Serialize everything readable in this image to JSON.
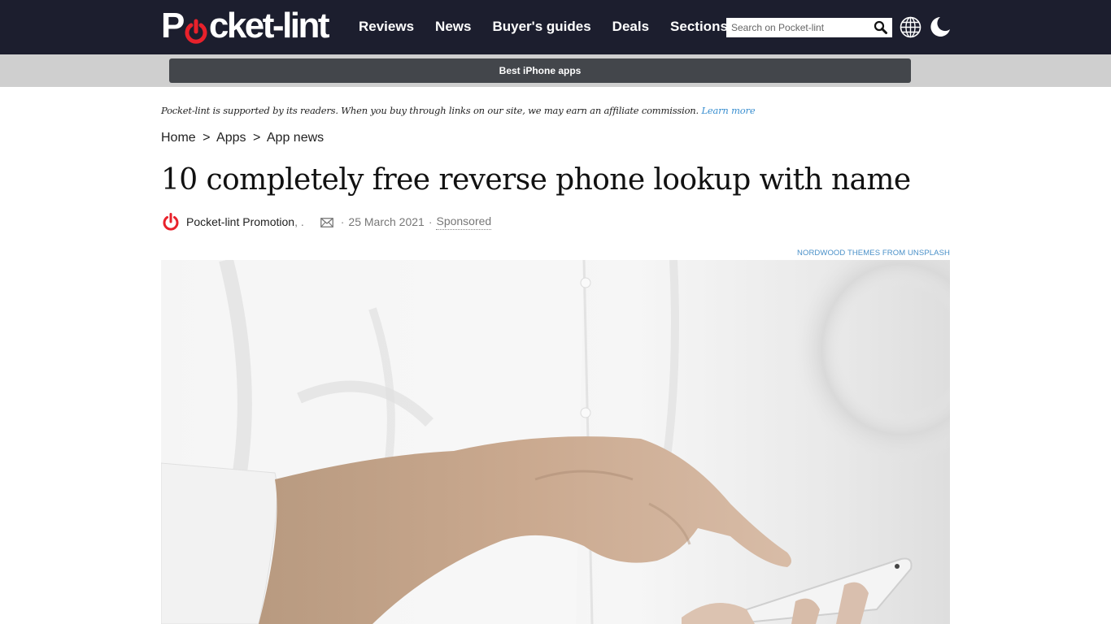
{
  "header": {
    "logo": {
      "text_before": "P",
      "text_after": "cket-lint",
      "accent_color": "#e8212b"
    },
    "nav": [
      {
        "label": "Reviews"
      },
      {
        "label": "News"
      },
      {
        "label": "Buyer's guides"
      },
      {
        "label": "Deals"
      },
      {
        "label": "Sections"
      }
    ],
    "search": {
      "placeholder": "Search on Pocket-lint",
      "value": ""
    },
    "icons": {
      "search": "search-icon",
      "region": "globe-icon",
      "theme": "moon-icon"
    },
    "background_color": "#1c1e2e"
  },
  "promo": {
    "label": "Best iPhone apps"
  },
  "disclaimer": {
    "text": "Pocket-lint is supported by its readers. When you buy through links on our site, we may earn an affiliate commission.",
    "link": "Learn more"
  },
  "breadcrumb": [
    {
      "label": "Home"
    },
    {
      "label": "Apps"
    },
    {
      "label": "App news"
    }
  ],
  "breadcrumb_separator": ">",
  "article": {
    "title": "10 completely free reverse phone lookup with name",
    "author": "Pocket-lint Promotion",
    "author_suffix": ", .",
    "date": "25 March 2021",
    "separator": "·",
    "label": "Sponsored",
    "image_credit": "NORDWOOD THEMES FROM UNSPLASH",
    "image_alt": "Man in white shirt tapping a smartphone"
  }
}
